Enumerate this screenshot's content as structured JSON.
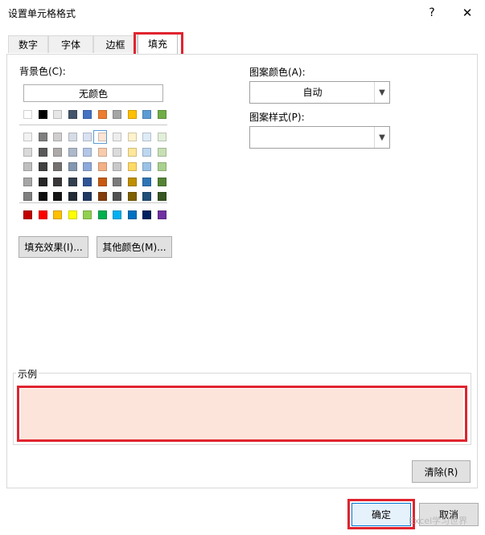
{
  "window": {
    "title": "设置单元格格式",
    "help": "?",
    "close": "✕"
  },
  "tabs": [
    "数字",
    "字体",
    "边框",
    "填充"
  ],
  "fill": {
    "bg_label": "背景色(C):",
    "no_color": "无颜色",
    "fill_effects": "填充效果(I)...",
    "more_colors": "其他颜色(M)..."
  },
  "pattern": {
    "color_label": "图案颜色(A):",
    "color_value": "自动",
    "style_label": "图案样式(P):",
    "style_value": ""
  },
  "sample": {
    "label": "示例",
    "color": "#fde4da"
  },
  "buttons": {
    "clear": "清除(R)",
    "ok": "确定",
    "cancel": "取消"
  },
  "watermark": "Excel学习世界",
  "palette": {
    "theme_top": [
      "#ffffff",
      "#000000",
      "#e7e6e6",
      "#44546a",
      "#4472c4",
      "#ed7d31",
      "#a5a5a5",
      "#ffc000",
      "#5b9bd5",
      "#70ad47"
    ],
    "theme_rows": [
      [
        "#f2f2f2",
        "#7f7f7f",
        "#d0cece",
        "#d6dce5",
        "#d9e1f2",
        "#fbe5d6",
        "#ededed",
        "#fff2cc",
        "#ddebf7",
        "#e2efda"
      ],
      [
        "#d9d9d9",
        "#595959",
        "#aeaaaa",
        "#adb9ca",
        "#b4c6e7",
        "#f8cbad",
        "#dbdbdb",
        "#ffe699",
        "#bdd7ee",
        "#c6e0b4"
      ],
      [
        "#bfbfbf",
        "#404040",
        "#757171",
        "#8497b0",
        "#8ea9db",
        "#f4b084",
        "#c9c9c9",
        "#ffd966",
        "#9bc2e6",
        "#a9d08e"
      ],
      [
        "#a6a6a6",
        "#262626",
        "#3a3838",
        "#333f4f",
        "#2f5597",
        "#c65911",
        "#7b7b7b",
        "#bf8f00",
        "#2e75b6",
        "#548235"
      ],
      [
        "#808080",
        "#0d0d0d",
        "#161616",
        "#222b35",
        "#203864",
        "#843c0c",
        "#525252",
        "#7f6000",
        "#1f4e78",
        "#375623"
      ]
    ],
    "standard": [
      "#c00000",
      "#ff0000",
      "#ffc000",
      "#ffff00",
      "#92d050",
      "#00b050",
      "#00b0f0",
      "#0070c0",
      "#002060",
      "#7030a0"
    ]
  }
}
